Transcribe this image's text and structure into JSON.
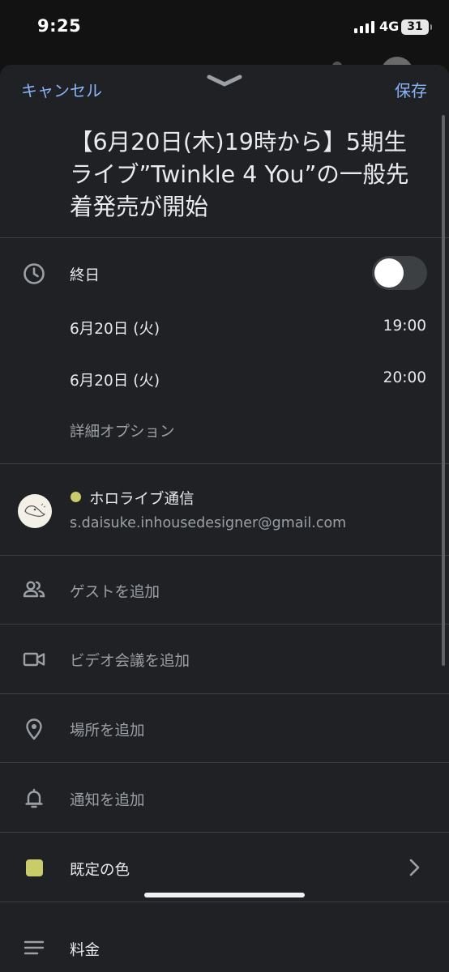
{
  "status_bar": {
    "time": "9:25",
    "network": "4G",
    "battery": "31"
  },
  "header": {
    "cancel_label": "キャンセル",
    "save_label": "保存"
  },
  "event": {
    "title": "【6月20日(木)19時から】5期生ライブ”Twinkle 4 You”の一般先着発売が開始"
  },
  "time_section": {
    "all_day_label": "終日",
    "all_day_enabled": false,
    "start_date": "6月20日 (火)",
    "start_time": "19:00",
    "end_date": "6月20日 (火)",
    "end_time": "20:00",
    "more_options_label": "詳細オプション"
  },
  "calendar": {
    "name": "ホロライブ通信",
    "email": "s.daisuke.inhousedesigner@gmail.com",
    "color": "#c9cc6a"
  },
  "actions": {
    "guests": "ゲストを追加",
    "video": "ビデオ会議を追加",
    "location": "場所を追加",
    "notification": "通知を追加",
    "color": "既定の色",
    "description": "料金"
  },
  "colors": {
    "accent": "#8ab4f8",
    "sheet_bg": "#202124",
    "calendar_color": "#c9cc6a"
  },
  "icons": [
    "clock-icon",
    "guests-icon",
    "video-icon",
    "location-pin-icon",
    "bell-icon",
    "description-icon",
    "chevron-right-icon",
    "chevron-down-icon"
  ]
}
